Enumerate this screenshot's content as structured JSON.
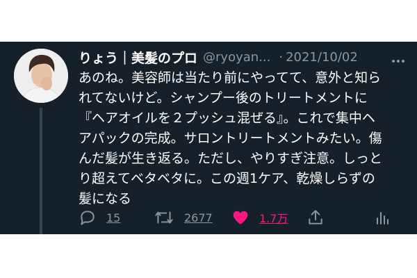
{
  "tweet": {
    "display_name": "りょう｜美髪のプロ",
    "handle": "@ryoyan...",
    "separator": "·",
    "date": "2021/10/02",
    "body_lines": [
      "あのね。美容師は当たり前にやってて、意外と知ら",
      "れてないけど。シャンプー後のトリートメントに",
      "『ヘアオイルを２プッシュ混ぜる』。これで集中ヘ",
      "アパックの完成。サロントリートメントみたい。傷",
      "んだ髪が生き返る。ただし、やりすぎ注意。しっと",
      "り超えてベタベタに。この週1ケア、乾燥しらずの",
      "髪になる"
    ],
    "actions": {
      "reply_count": "15",
      "retweet_count": "2677",
      "like_count": "1.7万"
    }
  },
  "colors": {
    "background": "#15202b",
    "text": "#ffffff",
    "secondary_text": "#8899a6",
    "like_accent": "#f91880"
  },
  "icons": {
    "more": "more-horizontal-icon",
    "reply": "reply-bubble-icon",
    "retweet": "retweet-arrows-icon",
    "like": "heart-icon",
    "share": "share-upload-icon",
    "analytics": "analytics-bars-icon"
  }
}
